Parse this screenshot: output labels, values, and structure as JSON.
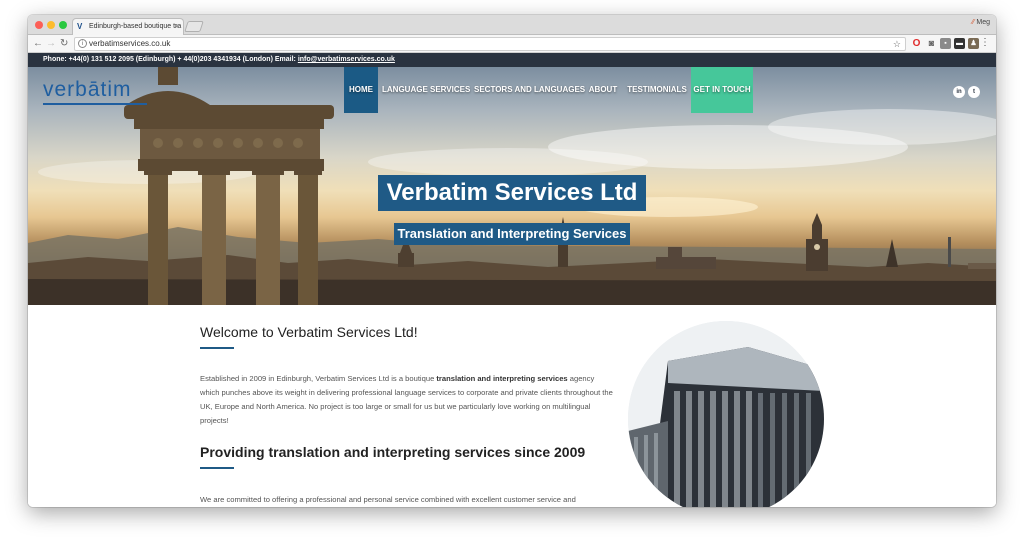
{
  "browser": {
    "tab_title": "Edinburgh-based boutique tra",
    "tab_favicon": "V",
    "tab_close": "×",
    "profile_name": "Meg",
    "url": "verbatimservices.co.uk"
  },
  "site": {
    "topbar": {
      "phone_text": "Phone: +44(0) 131 512 2095 (Edinburgh) + 44(0)203 4341934 (London) Email: ",
      "email": "info@verbatimservices.co.uk"
    },
    "logo": "verbātim",
    "nav": [
      "HOME",
      "LANGUAGE SERVICES",
      "SECTORS AND LANGUAGES",
      "ABOUT",
      "TESTIMONIALS",
      "GET IN TOUCH"
    ],
    "social": [
      "in",
      "t"
    ],
    "hero": {
      "title": "Verbatim Services Ltd",
      "subtitle": "Translation and Interpreting Services"
    },
    "welcome": {
      "heading": "Welcome to Verbatim Services Ltd!",
      "para_before": "Established in 2009 in Edinburgh, Verbatim Services Ltd is a boutique ",
      "para_bold": "translation and interpreting services",
      "para_after": " agency which punches above its weight in delivering professional language services to corporate and private clients throughout the UK, Europe and North America.  No project is too large or small for us but we particularly love working on multilingual projects!"
    },
    "providing": {
      "heading_before": "Providing ",
      "heading_bold": "translation and interpreting services",
      "heading_after": " since 2009",
      "para": "We are committed to offering a professional and personal service combined with excellent customer service and"
    }
  },
  "colors": {
    "brand_blue": "#1f5a86",
    "cta_green": "#46c79a",
    "topbar_bg": "#2a3340"
  },
  "icons": [
    "info-icon",
    "star-icon",
    "back-arrow-icon",
    "forward-arrow-icon",
    "reload-icon",
    "menu-dots-icon",
    "linkedin-icon",
    "twitter-icon"
  ]
}
